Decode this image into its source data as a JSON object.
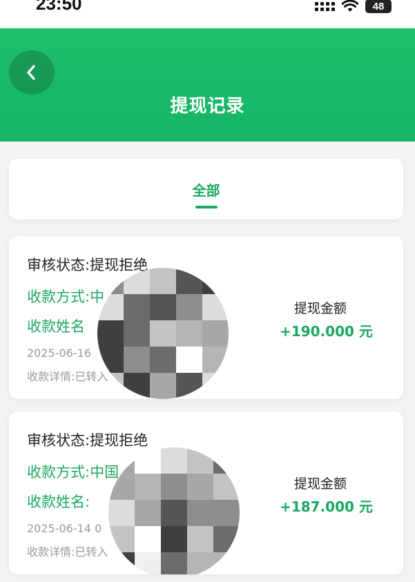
{
  "status_bar": {
    "time": "23:50",
    "battery": "48"
  },
  "header": {
    "title": "提现记录"
  },
  "tabs": [
    {
      "label": "全部",
      "active": true
    }
  ],
  "records": [
    {
      "status": "审核状态:提现拒绝",
      "method": "收款方式:中",
      "name": "收款姓名",
      "date": "2025-06-16",
      "detail": "收款详情:已转入",
      "amount_label": "提现金额",
      "amount": "+190.000 元"
    },
    {
      "status": "审核状态:提现拒绝",
      "method": "收款方式:中国",
      "name": "收款姓名:",
      "date": "2025-06-14 0",
      "detail": "收款详情:已转入",
      "amount_label": "提现金额",
      "amount": "+187.000 元"
    }
  ],
  "colors": {
    "brand_green": "#16b566",
    "accent_text_green": "#1aa85f"
  },
  "mosaic_shades": [
    "#3f3f3f",
    "#6c6c6c",
    "#8e8e8e",
    "#a7a7a7",
    "#c3c3c3",
    "#dcdcdc",
    "#efefef",
    "#ffffff",
    "#555555",
    "#b5b5b5"
  ]
}
